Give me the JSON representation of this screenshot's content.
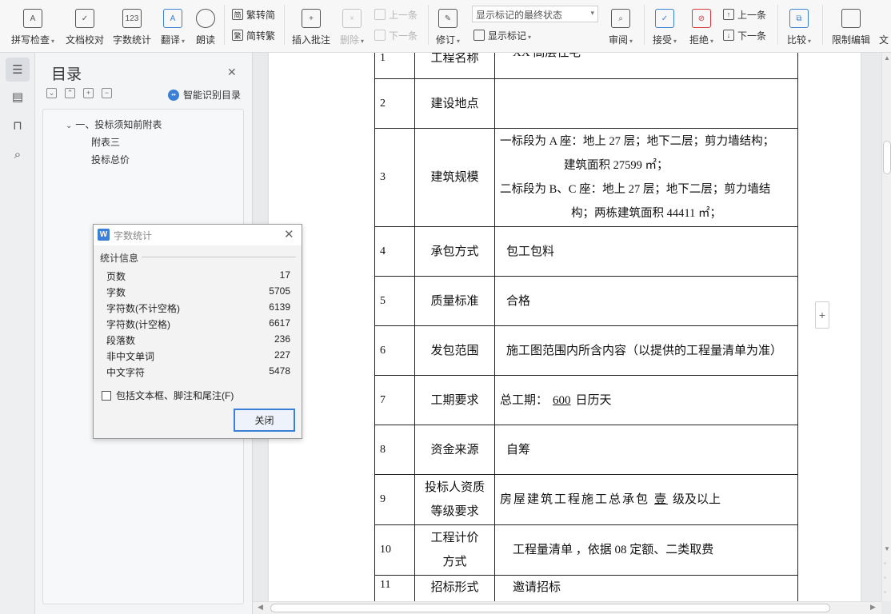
{
  "ribbon": {
    "spell_check": "拼写检查",
    "doc_proof": "文档校对",
    "word_count": "字数统计",
    "translate": "翻译",
    "read_aloud": "朗读",
    "trad_to_simp": "繁转简",
    "simp_to_trad": "简转繁",
    "insert_comment": "插入批注",
    "delete": "删除",
    "prev_comment": "上一条",
    "next_comment": "下一条",
    "revise": "修订",
    "display_select": "显示标记的最终状态",
    "show_markup": "显示标记",
    "review": "审阅",
    "accept": "接受",
    "reject": "拒绝",
    "prev_change": "上一条",
    "next_change": "下一条",
    "compare": "比较",
    "restrict_edit": "限制编辑",
    "doc_cut": "文"
  },
  "toc": {
    "title": "目录",
    "smart_label": "智能识别目录",
    "items": [
      "一、投标须知前附表",
      "附表三",
      "投标总价"
    ]
  },
  "table": {
    "rows": [
      {
        "num": "1",
        "label": "工程名称",
        "value": "XX 高层住宅"
      },
      {
        "num": "2",
        "label": "建设地点",
        "value": ""
      },
      {
        "num": "3",
        "label": "建筑规模",
        "line1": "一标段为 A 座：地上 27 层；地下二层；剪力墙结构；",
        "line2": "建筑面积  27599 ㎡；",
        "line3": "二标段为 B、C 座：地上 27 层；地下二层；剪力墙结",
        "line4": "构；两栋建筑面积  44411 ㎡；"
      },
      {
        "num": "4",
        "label": "承包方式",
        "value": "包工包料"
      },
      {
        "num": "5",
        "label": "质量标准",
        "value": "合格"
      },
      {
        "num": "6",
        "label": "发包范围",
        "value": "施工图范围内所含内容（以提供的工程量清单为准）"
      },
      {
        "num": "7",
        "label": "工期要求",
        "prefix": "总工期：",
        "underline": "600",
        "suffix": "日历天"
      },
      {
        "num": "8",
        "label": "资金来源",
        "value": "自筹"
      },
      {
        "num": "9",
        "label1": "投标人资质",
        "label2": "等级要求",
        "prefix": "房屋建筑工程施工总承包",
        "underline": "壹",
        "suffix": "级及以上"
      },
      {
        "num": "10",
        "label1": "工程计价",
        "label2": "方式",
        "value": "工程量清单 ，依据 08 定额、二类取费"
      },
      {
        "num": "11",
        "label": "招标形式",
        "value": "邀请招标"
      }
    ]
  },
  "dialog": {
    "title": "字数统计",
    "group": "统计信息",
    "stats": [
      {
        "label": "页数",
        "value": "17"
      },
      {
        "label": "字数",
        "value": "5705"
      },
      {
        "label": "字符数(不计空格)",
        "value": "6139"
      },
      {
        "label": "字符数(计空格)",
        "value": "6617"
      },
      {
        "label": "段落数",
        "value": "236"
      },
      {
        "label": "非中文单词",
        "value": "227"
      },
      {
        "label": "中文字符",
        "value": "5478"
      }
    ],
    "checkbox_label": "包括文本框、脚注和尾注(F)",
    "close_button": "关闭"
  }
}
